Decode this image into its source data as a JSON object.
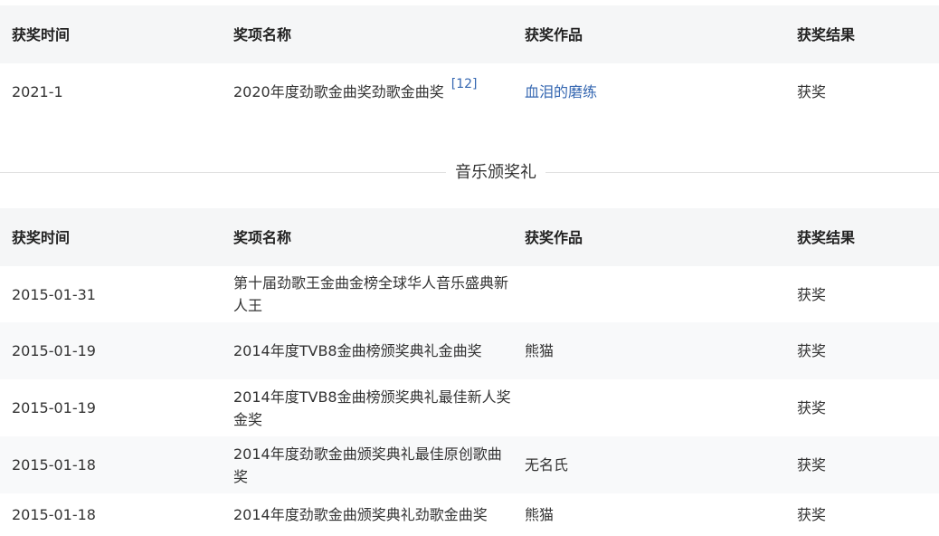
{
  "headers": {
    "time": "获奖时间",
    "award": "奖项名称",
    "work": "获奖作品",
    "result": "获奖结果"
  },
  "table1": {
    "rows": [
      {
        "time": "2021-1",
        "award": "2020年度劲歌金曲奖劲歌金曲奖",
        "ref": "[12]",
        "work": "血泪的磨练",
        "result": "获奖"
      }
    ]
  },
  "section": {
    "title": "音乐颁奖礼"
  },
  "table2": {
    "rows": [
      {
        "time": "2015-01-31",
        "award": "第十届劲歌王金曲金榜全球华人音乐盛典新人王",
        "work": "",
        "result": "获奖"
      },
      {
        "time": "2015-01-19",
        "award": "2014年度TVB8金曲榜颁奖典礼金曲奖",
        "work": "熊猫",
        "result": "获奖"
      },
      {
        "time": "2015-01-19",
        "award": "2014年度TVB8金曲榜颁奖典礼最佳新人奖金奖",
        "work": "",
        "result": "获奖"
      },
      {
        "time": "2015-01-18",
        "award": "2014年度劲歌金曲颁奖典礼最佳原创歌曲奖",
        "work": "无名氏",
        "result": "获奖"
      },
      {
        "time": "2015-01-18",
        "award": "2014年度劲歌金曲颁奖典礼劲歌金曲奖",
        "work": "熊猫",
        "result": "获奖"
      }
    ]
  }
}
